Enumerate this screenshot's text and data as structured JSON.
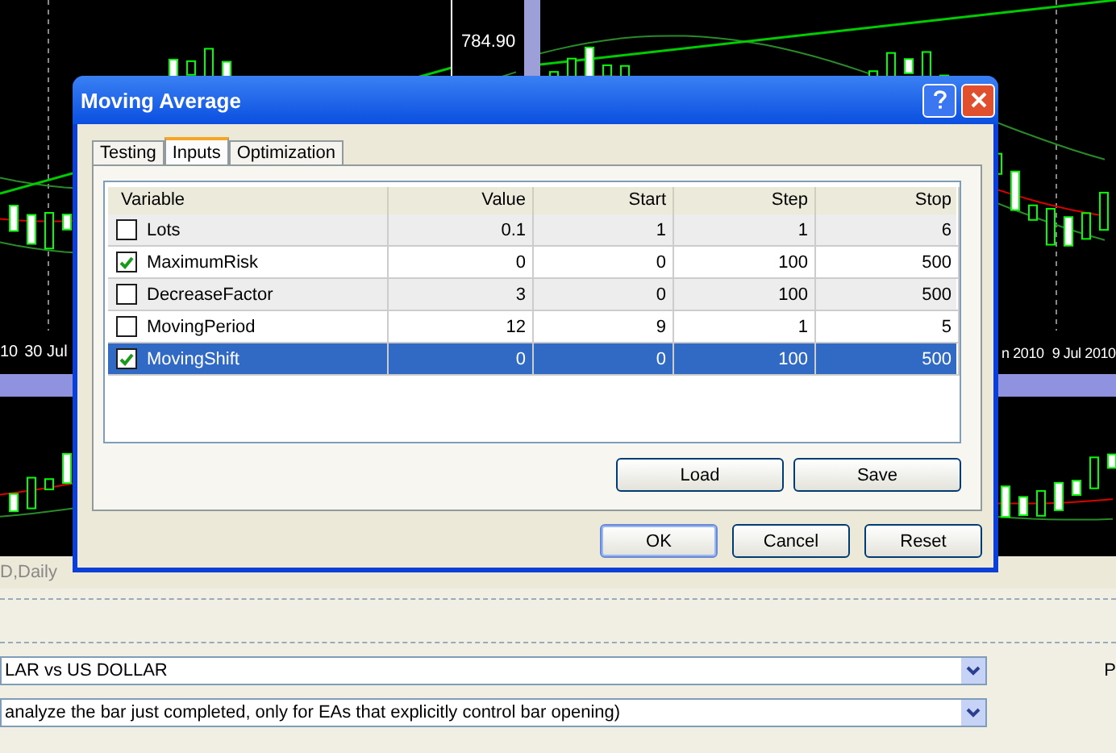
{
  "charts": {
    "price_label": "784.90",
    "left_dates": [
      "10",
      "30 Jul"
    ],
    "right_dates": [
      "n 2010",
      "9 Jul 2010"
    ],
    "bottom_label": "D,Daily"
  },
  "tester": {
    "symbol": "LAR vs US DOLLAR",
    "model": "analyze the bar just completed, only for EAs that explicitly control bar opening)",
    "side_label": "P"
  },
  "dialog": {
    "title": "Moving Average",
    "tabs": [
      {
        "label": "Testing",
        "selected": false
      },
      {
        "label": "Inputs",
        "selected": true
      },
      {
        "label": "Optimization",
        "selected": false
      }
    ],
    "columns": [
      "Variable",
      "Value",
      "Start",
      "Step",
      "Stop"
    ],
    "rows": [
      {
        "name": "Lots",
        "checked": false,
        "selected": false,
        "value": "0.1",
        "start": "1",
        "step": "1",
        "stop": "6"
      },
      {
        "name": "MaximumRisk",
        "checked": true,
        "selected": false,
        "value": "0",
        "start": "0",
        "step": "100",
        "stop": "500"
      },
      {
        "name": "DecreaseFactor",
        "checked": false,
        "selected": false,
        "value": "3",
        "start": "0",
        "step": "100",
        "stop": "500"
      },
      {
        "name": "MovingPeriod",
        "checked": false,
        "selected": false,
        "value": "12",
        "start": "9",
        "step": "1",
        "stop": "5"
      },
      {
        "name": "MovingShift",
        "checked": true,
        "selected": true,
        "value": "0",
        "start": "0",
        "step": "100",
        "stop": "500"
      }
    ],
    "list_buttons": [
      "Load",
      "Save"
    ],
    "buttons": [
      "OK",
      "Cancel",
      "Reset"
    ]
  }
}
